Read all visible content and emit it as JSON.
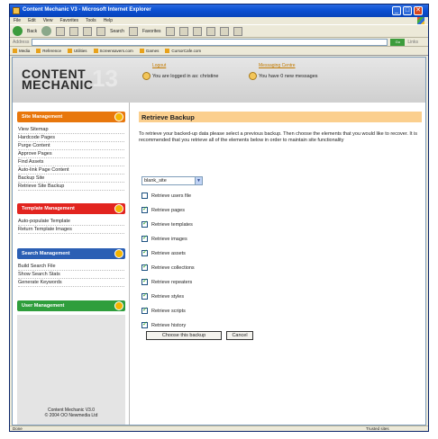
{
  "window": {
    "title": "Content Mechanic V3 - Microsoft Internet Explorer",
    "minimize": "_",
    "maximize": "□",
    "close": "✕"
  },
  "menu": [
    "File",
    "Edit",
    "View",
    "Favorites",
    "Tools",
    "Help"
  ],
  "toolbar": {
    "back": "Back",
    "search": "Search",
    "favorites": "Favorites"
  },
  "address": {
    "label": "Address",
    "go": "Go",
    "links": "Links"
  },
  "links_bar": [
    "Media",
    "Reference",
    "Utilities",
    "Screensavers.com",
    "Games",
    "CursorCafe.com"
  ],
  "header": {
    "logo_line1": "CONTENT",
    "logo_line2": "MECHANIC",
    "logo_number": "13",
    "logout_link": "Logout",
    "logged_in_text": "You are logged in as: christine",
    "messages_link": "Messaging Centre",
    "messages_text": "You have 0 new messages"
  },
  "sidebar": {
    "site_management": {
      "heading": "Site Management",
      "items": [
        "View Sitemap",
        "Hardcode Pages",
        "Purge Content",
        "Approve Pages",
        "Find Assets",
        "Auto-link Page Content",
        "Backup Site",
        "Retrieve Site Backup"
      ]
    },
    "template_management": {
      "heading": "Template Management",
      "items": [
        "Auto-populate Template",
        "Return Template Images"
      ]
    },
    "search_management": {
      "heading": "Search Management",
      "items": [
        "Build Search File",
        "Show Search Stats",
        "Generate Keywords"
      ]
    },
    "user_management": {
      "heading": "User Management"
    },
    "footer_line1": "Content Mechanic V3.0",
    "footer_line2": "© 2004 OO Newmedia Ltd"
  },
  "main": {
    "title": "Retrieve Backup",
    "intro": "To retrieve your backed-up data please select a previous backup. Then choose the elements that you would like to recover. It is recommended that you retrieve all of the elements below in order to maintain site functionality",
    "backup_select_value": "blank_site",
    "options": [
      {
        "label": "Retrieve users file",
        "checked": false
      },
      {
        "label": "Retrieve pages",
        "checked": true
      },
      {
        "label": "Retrieve templates",
        "checked": true
      },
      {
        "label": "Retrieve images",
        "checked": true
      },
      {
        "label": "Retrieve assets",
        "checked": true
      },
      {
        "label": "Retrieve collections",
        "checked": true
      },
      {
        "label": "Retrieve repeaters",
        "checked": true
      },
      {
        "label": "Retrieve styles",
        "checked": true
      },
      {
        "label": "Retrieve scripts",
        "checked": true
      },
      {
        "label": "Retrieve history",
        "checked": true
      }
    ],
    "choose_button": "Choose this backup",
    "cancel_button": "Cancel"
  },
  "status": {
    "left": "Done",
    "right": "Trusted sites"
  },
  "colors": {
    "site_management": "#e8770c",
    "template_management": "#e2241f",
    "search_management": "#2b5fb4",
    "user_management": "#2f9e3c",
    "title_bar": "#0a4fd1",
    "main_title_bg": "#fbcf8e"
  }
}
